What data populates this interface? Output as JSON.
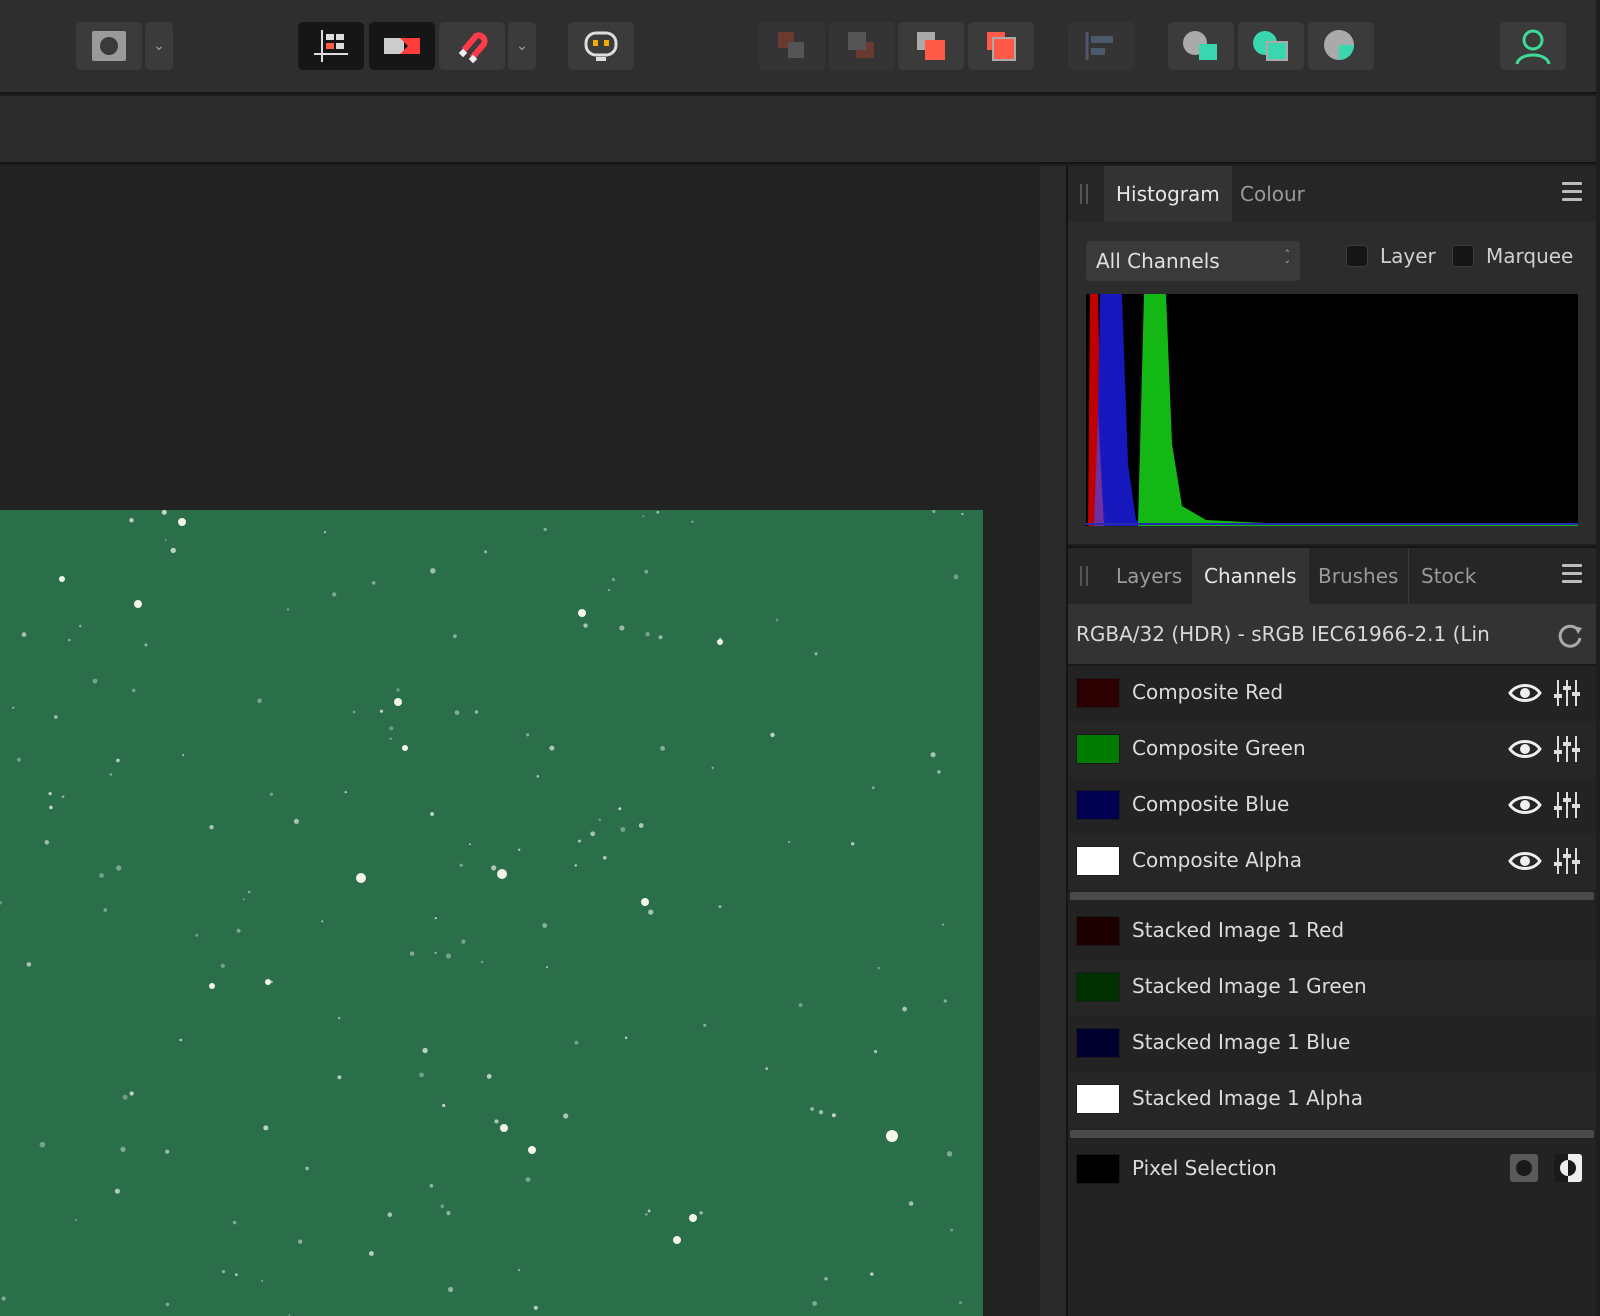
{
  "toolbar": {
    "buttons": [
      {
        "name": "selection-mode-icon"
      },
      {
        "name": "dropdown-chevron-icon",
        "label": "⌄"
      },
      {
        "name": "snapping-grid-icon"
      },
      {
        "name": "toggle-fill-icon"
      },
      {
        "name": "magnet-snapping-icon"
      },
      {
        "name": "dropdown-chevron-icon",
        "label": "⌄"
      },
      {
        "name": "assistant-robot-icon"
      },
      {
        "name": "arrange-back-icon"
      },
      {
        "name": "arrange-backward-icon"
      },
      {
        "name": "arrange-forward-icon"
      },
      {
        "name": "arrange-front-icon"
      },
      {
        "name": "align-icon"
      },
      {
        "name": "boolean-add-icon"
      },
      {
        "name": "boolean-subtract-icon"
      },
      {
        "name": "boolean-intersect-icon"
      },
      {
        "name": "user-account-icon"
      }
    ]
  },
  "histogram_panel": {
    "tabs": [
      "Histogram",
      "Colour"
    ],
    "active_tab": "Histogram",
    "channel_select": "All Channels",
    "checkboxes": [
      "Layer",
      "Marquee"
    ]
  },
  "channels_panel": {
    "tabs": [
      "Layers",
      "Channels",
      "Brushes",
      "Stock"
    ],
    "active_tab": "Channels",
    "format": "RGBA/32 (HDR) - sRGB IEC61966-2.1 (Lin",
    "composite": [
      {
        "label": "Composite Red",
        "color": "#2a0000"
      },
      {
        "label": "Composite Green",
        "color": "#007a00"
      },
      {
        "label": "Composite Blue",
        "color": "#000050"
      },
      {
        "label": "Composite Alpha",
        "color": "#ffffff"
      }
    ],
    "stacked": [
      {
        "label": "Stacked Image 1 Red",
        "color": "#1c0000"
      },
      {
        "label": "Stacked Image 1 Green",
        "color": "#003000"
      },
      {
        "label": "Stacked Image 1 Blue",
        "color": "#000030"
      },
      {
        "label": "Stacked Image 1 Alpha",
        "color": "#ffffff"
      }
    ],
    "pixel_selection": {
      "label": "Pixel Selection",
      "color": "#000000"
    }
  },
  "colors": {
    "photo_bg": "#2a6e4a",
    "accent_red": "#ff5a48",
    "accent_teal": "#3ad6b0",
    "accent_green_user": "#3ddc97"
  }
}
